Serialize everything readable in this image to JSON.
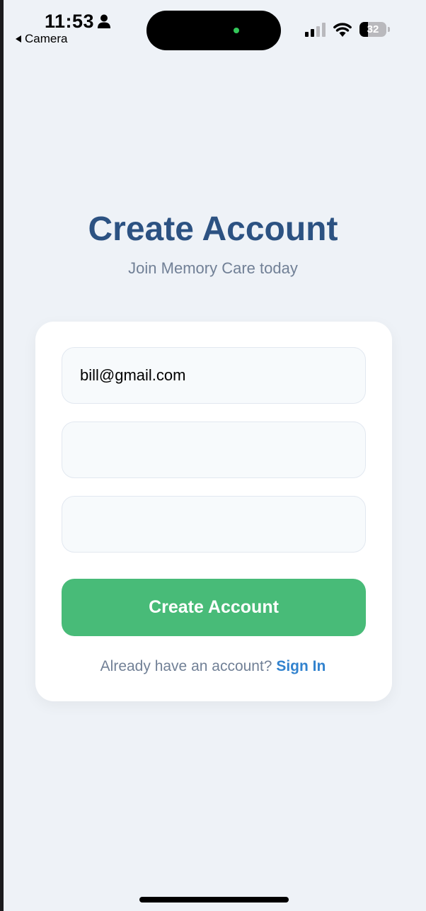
{
  "status_bar": {
    "time": "11:53",
    "back_label": "Camera",
    "battery_level": "32",
    "battery_fraction": 0.32
  },
  "header": {
    "title": "Create Account",
    "subtitle": "Join Memory Care today"
  },
  "form": {
    "email_value": "bill@gmail.com",
    "password_value": "",
    "confirm_password_value": "",
    "submit_label": "Create Account"
  },
  "footer": {
    "prompt": "Already have an account?",
    "link": "Sign In"
  },
  "colors": {
    "background": "#eef2f7",
    "title": "#2c5282",
    "primary_button": "#48bb78",
    "link": "#3182ce"
  },
  "icons": [
    "person-icon",
    "back-arrow-icon",
    "signal-icon",
    "wifi-icon",
    "battery-icon"
  ]
}
